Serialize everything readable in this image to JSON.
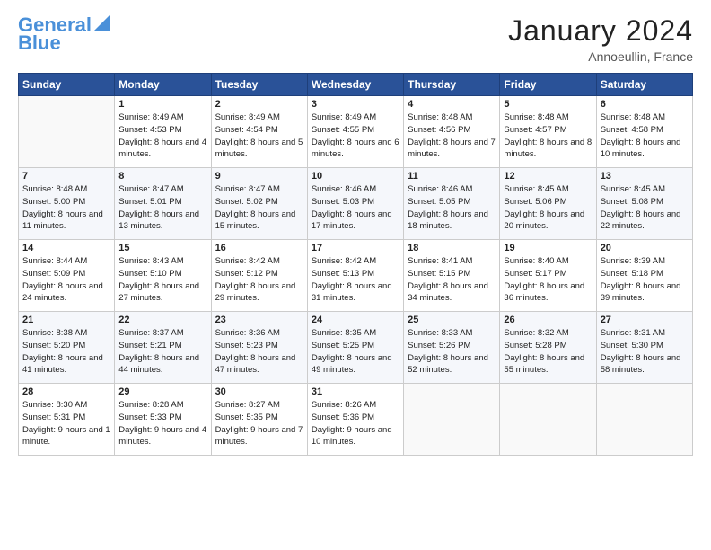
{
  "logo": {
    "line1": "General",
    "line2": "Blue"
  },
  "header": {
    "month": "January 2024",
    "location": "Annoeullin, France"
  },
  "weekdays": [
    "Sunday",
    "Monday",
    "Tuesday",
    "Wednesday",
    "Thursday",
    "Friday",
    "Saturday"
  ],
  "weeks": [
    [
      {
        "day": "",
        "sunrise": "",
        "sunset": "",
        "daylight": ""
      },
      {
        "day": "1",
        "sunrise": "Sunrise: 8:49 AM",
        "sunset": "Sunset: 4:53 PM",
        "daylight": "Daylight: 8 hours and 4 minutes."
      },
      {
        "day": "2",
        "sunrise": "Sunrise: 8:49 AM",
        "sunset": "Sunset: 4:54 PM",
        "daylight": "Daylight: 8 hours and 5 minutes."
      },
      {
        "day": "3",
        "sunrise": "Sunrise: 8:49 AM",
        "sunset": "Sunset: 4:55 PM",
        "daylight": "Daylight: 8 hours and 6 minutes."
      },
      {
        "day": "4",
        "sunrise": "Sunrise: 8:48 AM",
        "sunset": "Sunset: 4:56 PM",
        "daylight": "Daylight: 8 hours and 7 minutes."
      },
      {
        "day": "5",
        "sunrise": "Sunrise: 8:48 AM",
        "sunset": "Sunset: 4:57 PM",
        "daylight": "Daylight: 8 hours and 8 minutes."
      },
      {
        "day": "6",
        "sunrise": "Sunrise: 8:48 AM",
        "sunset": "Sunset: 4:58 PM",
        "daylight": "Daylight: 8 hours and 10 minutes."
      }
    ],
    [
      {
        "day": "7",
        "sunrise": "Sunrise: 8:48 AM",
        "sunset": "Sunset: 5:00 PM",
        "daylight": "Daylight: 8 hours and 11 minutes."
      },
      {
        "day": "8",
        "sunrise": "Sunrise: 8:47 AM",
        "sunset": "Sunset: 5:01 PM",
        "daylight": "Daylight: 8 hours and 13 minutes."
      },
      {
        "day": "9",
        "sunrise": "Sunrise: 8:47 AM",
        "sunset": "Sunset: 5:02 PM",
        "daylight": "Daylight: 8 hours and 15 minutes."
      },
      {
        "day": "10",
        "sunrise": "Sunrise: 8:46 AM",
        "sunset": "Sunset: 5:03 PM",
        "daylight": "Daylight: 8 hours and 17 minutes."
      },
      {
        "day": "11",
        "sunrise": "Sunrise: 8:46 AM",
        "sunset": "Sunset: 5:05 PM",
        "daylight": "Daylight: 8 hours and 18 minutes."
      },
      {
        "day": "12",
        "sunrise": "Sunrise: 8:45 AM",
        "sunset": "Sunset: 5:06 PM",
        "daylight": "Daylight: 8 hours and 20 minutes."
      },
      {
        "day": "13",
        "sunrise": "Sunrise: 8:45 AM",
        "sunset": "Sunset: 5:08 PM",
        "daylight": "Daylight: 8 hours and 22 minutes."
      }
    ],
    [
      {
        "day": "14",
        "sunrise": "Sunrise: 8:44 AM",
        "sunset": "Sunset: 5:09 PM",
        "daylight": "Daylight: 8 hours and 24 minutes."
      },
      {
        "day": "15",
        "sunrise": "Sunrise: 8:43 AM",
        "sunset": "Sunset: 5:10 PM",
        "daylight": "Daylight: 8 hours and 27 minutes."
      },
      {
        "day": "16",
        "sunrise": "Sunrise: 8:42 AM",
        "sunset": "Sunset: 5:12 PM",
        "daylight": "Daylight: 8 hours and 29 minutes."
      },
      {
        "day": "17",
        "sunrise": "Sunrise: 8:42 AM",
        "sunset": "Sunset: 5:13 PM",
        "daylight": "Daylight: 8 hours and 31 minutes."
      },
      {
        "day": "18",
        "sunrise": "Sunrise: 8:41 AM",
        "sunset": "Sunset: 5:15 PM",
        "daylight": "Daylight: 8 hours and 34 minutes."
      },
      {
        "day": "19",
        "sunrise": "Sunrise: 8:40 AM",
        "sunset": "Sunset: 5:17 PM",
        "daylight": "Daylight: 8 hours and 36 minutes."
      },
      {
        "day": "20",
        "sunrise": "Sunrise: 8:39 AM",
        "sunset": "Sunset: 5:18 PM",
        "daylight": "Daylight: 8 hours and 39 minutes."
      }
    ],
    [
      {
        "day": "21",
        "sunrise": "Sunrise: 8:38 AM",
        "sunset": "Sunset: 5:20 PM",
        "daylight": "Daylight: 8 hours and 41 minutes."
      },
      {
        "day": "22",
        "sunrise": "Sunrise: 8:37 AM",
        "sunset": "Sunset: 5:21 PM",
        "daylight": "Daylight: 8 hours and 44 minutes."
      },
      {
        "day": "23",
        "sunrise": "Sunrise: 8:36 AM",
        "sunset": "Sunset: 5:23 PM",
        "daylight": "Daylight: 8 hours and 47 minutes."
      },
      {
        "day": "24",
        "sunrise": "Sunrise: 8:35 AM",
        "sunset": "Sunset: 5:25 PM",
        "daylight": "Daylight: 8 hours and 49 minutes."
      },
      {
        "day": "25",
        "sunrise": "Sunrise: 8:33 AM",
        "sunset": "Sunset: 5:26 PM",
        "daylight": "Daylight: 8 hours and 52 minutes."
      },
      {
        "day": "26",
        "sunrise": "Sunrise: 8:32 AM",
        "sunset": "Sunset: 5:28 PM",
        "daylight": "Daylight: 8 hours and 55 minutes."
      },
      {
        "day": "27",
        "sunrise": "Sunrise: 8:31 AM",
        "sunset": "Sunset: 5:30 PM",
        "daylight": "Daylight: 8 hours and 58 minutes."
      }
    ],
    [
      {
        "day": "28",
        "sunrise": "Sunrise: 8:30 AM",
        "sunset": "Sunset: 5:31 PM",
        "daylight": "Daylight: 9 hours and 1 minute."
      },
      {
        "day": "29",
        "sunrise": "Sunrise: 8:28 AM",
        "sunset": "Sunset: 5:33 PM",
        "daylight": "Daylight: 9 hours and 4 minutes."
      },
      {
        "day": "30",
        "sunrise": "Sunrise: 8:27 AM",
        "sunset": "Sunset: 5:35 PM",
        "daylight": "Daylight: 9 hours and 7 minutes."
      },
      {
        "day": "31",
        "sunrise": "Sunrise: 8:26 AM",
        "sunset": "Sunset: 5:36 PM",
        "daylight": "Daylight: 9 hours and 10 minutes."
      },
      {
        "day": "",
        "sunrise": "",
        "sunset": "",
        "daylight": ""
      },
      {
        "day": "",
        "sunrise": "",
        "sunset": "",
        "daylight": ""
      },
      {
        "day": "",
        "sunrise": "",
        "sunset": "",
        "daylight": ""
      }
    ]
  ]
}
